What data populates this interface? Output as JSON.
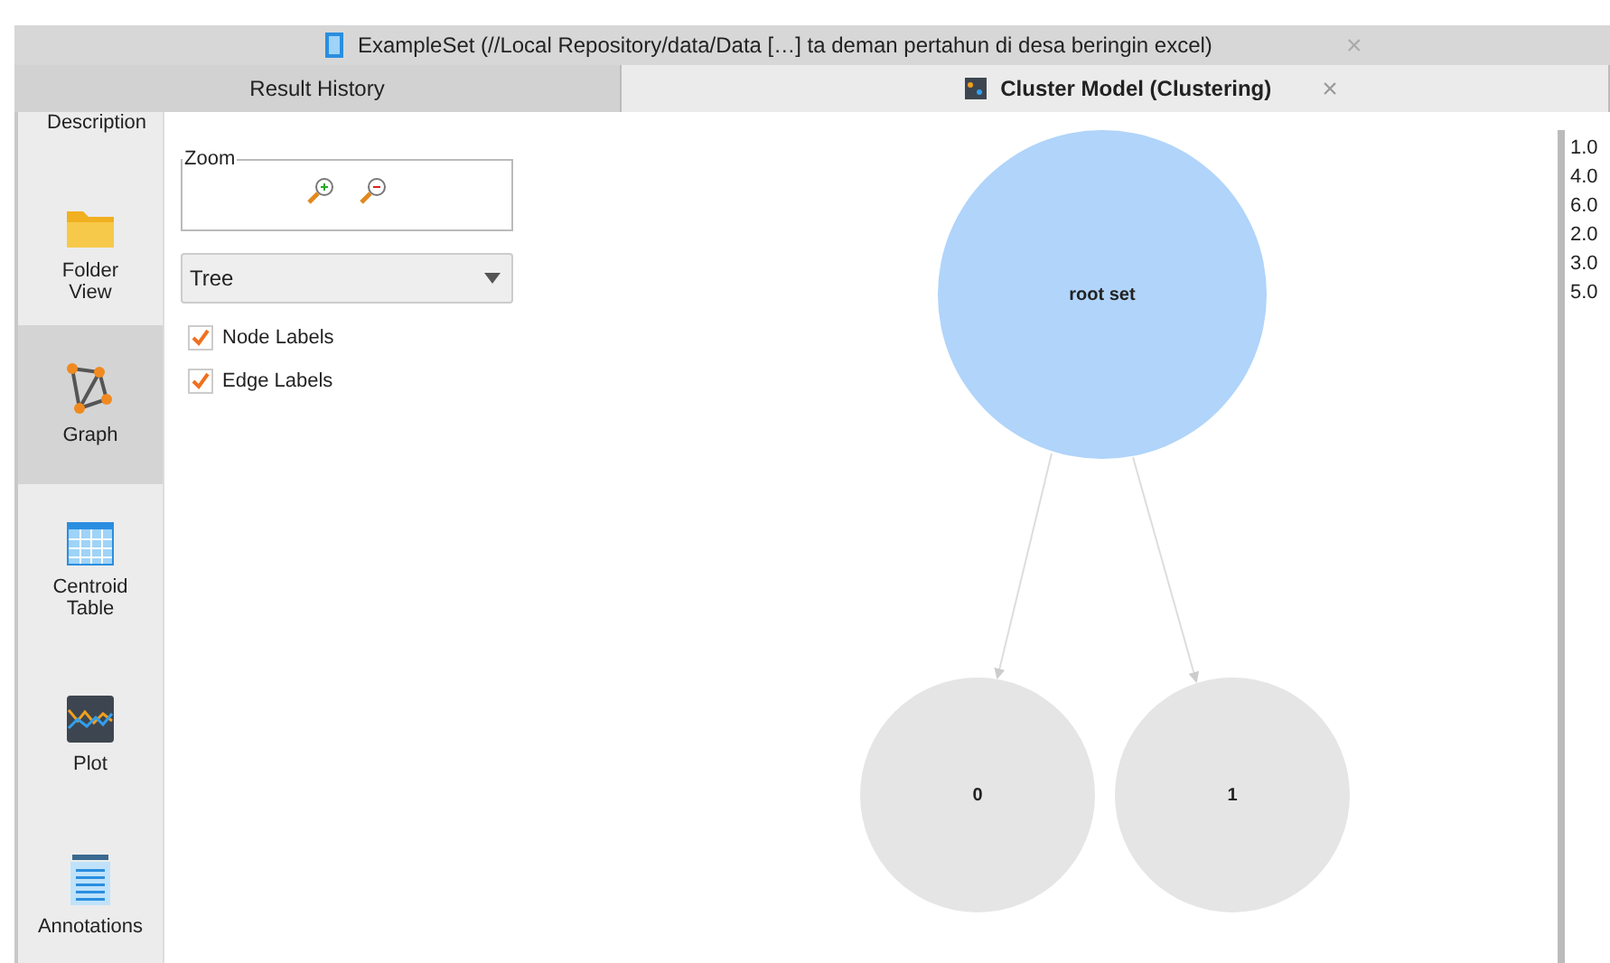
{
  "document_tab": {
    "title": "ExampleSet (//Local Repository/data/Data […] ta deman pertahun di desa beringin excel)",
    "close": "×"
  },
  "tabs": [
    {
      "label": "Result History",
      "selected": false
    },
    {
      "label": "Cluster Model (Clustering)",
      "selected": true,
      "close": "×"
    }
  ],
  "sidebar": {
    "items": [
      {
        "label": "Description",
        "kind": "none",
        "selected": false
      },
      {
        "label": "Folder View",
        "kind": "folder",
        "selected": false
      },
      {
        "label": "Graph",
        "kind": "graph",
        "selected": true
      },
      {
        "label": "Centroid Table",
        "kind": "table",
        "selected": false
      },
      {
        "label": "Plot",
        "kind": "plot",
        "selected": false
      },
      {
        "label": "Annotations",
        "kind": "notes",
        "selected": false
      }
    ]
  },
  "zoom": {
    "title": "Zoom"
  },
  "layout_select": {
    "value": "Tree"
  },
  "options": [
    {
      "label": "Node Labels",
      "checked": true
    },
    {
      "label": "Edge Labels",
      "checked": true
    }
  ],
  "graph": {
    "nodes": [
      {
        "label": "root set",
        "kind": "root"
      },
      {
        "label": "0",
        "kind": "leaf"
      },
      {
        "label": "1",
        "kind": "leaf"
      }
    ]
  },
  "legend": [
    "1.0",
    "4.0",
    "6.0",
    "2.0",
    "3.0",
    "5.0"
  ]
}
